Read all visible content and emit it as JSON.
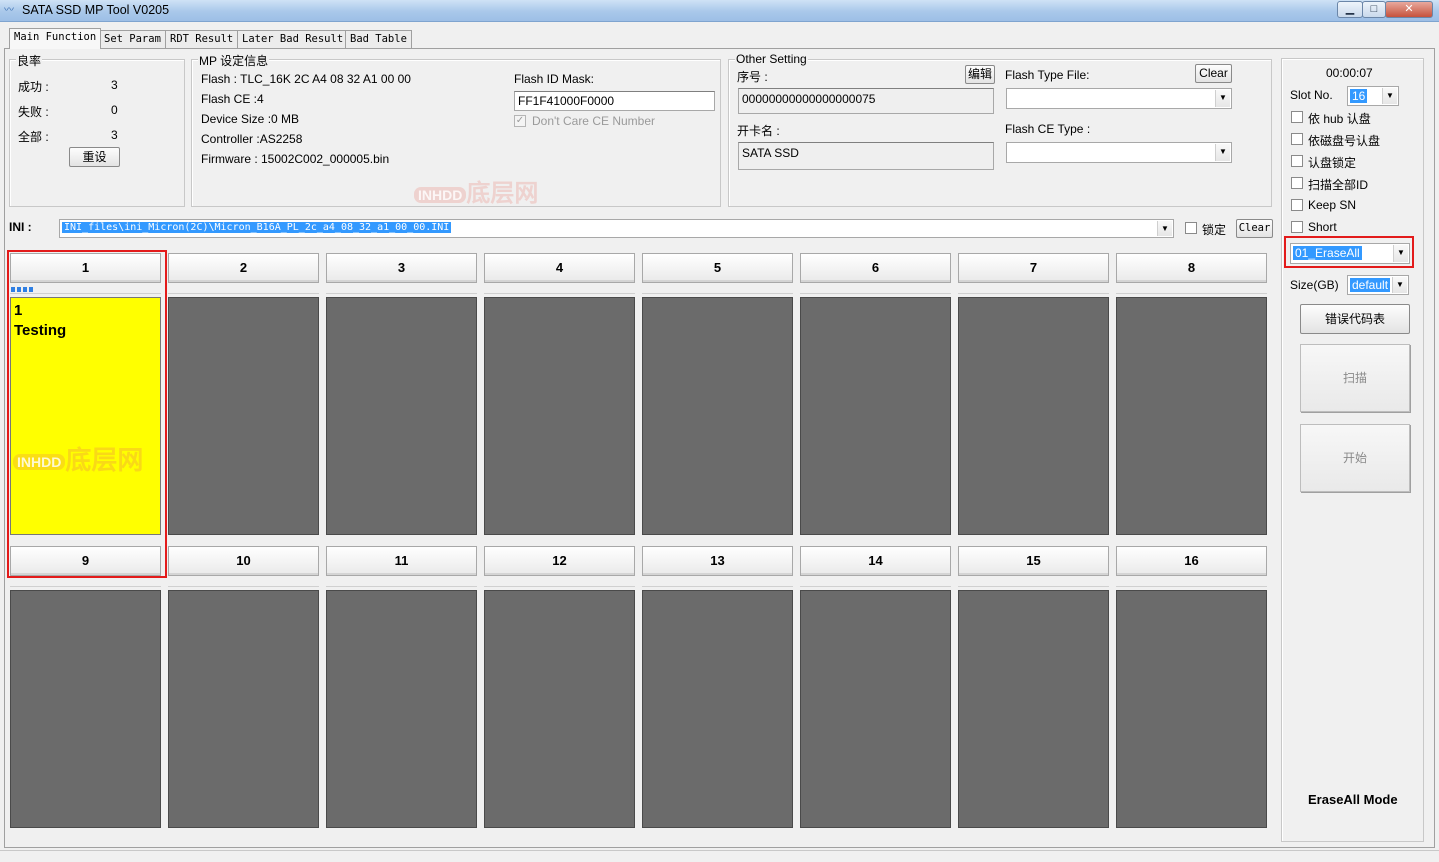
{
  "window": {
    "title": "SATA SSD MP Tool V0205",
    "buttons": {
      "minimize": "▁",
      "maximize": "□",
      "close": "✕"
    }
  },
  "tabs": [
    {
      "label": "Main Function",
      "active": true
    },
    {
      "label": "Set Param",
      "active": false
    },
    {
      "label": "RDT Result",
      "active": false
    },
    {
      "label": "Later Bad Result",
      "active": false
    },
    {
      "label": "Bad Table",
      "active": false
    }
  ],
  "yield_box": {
    "title": "良率",
    "success_label": "成功 :",
    "success_value": "3",
    "fail_label": "失败 :",
    "fail_value": "0",
    "total_label": "全部 :",
    "total_value": "3",
    "reset_label": "重设"
  },
  "mp_info": {
    "title": "MP 设定信息",
    "flash": "Flash : TLC_16K 2C A4 08 32 A1 00 00",
    "flash_ce": "Flash CE :4",
    "device_size": "Device Size :0 MB",
    "controller": "Controller :AS2258",
    "firmware": "Firmware : 15002C002_000005.bin",
    "flash_id_mask_label": "Flash ID Mask:",
    "flash_id_mask_value": "FF1F41000F0000",
    "dont_care_ce_label": "Don't Care CE Number",
    "dont_care_ce_checked": true
  },
  "other_setting": {
    "title": "Other Setting",
    "serial_label": "序号 :",
    "edit_label": "编辑",
    "serial_value": "00000000000000000075",
    "card_name_label": "开卡名 :",
    "card_name_value": "SATA SSD",
    "flash_type_file_label": "Flash Type File:",
    "clear_label": "Clear",
    "flash_type_file_value": "",
    "flash_ce_type_label": "Flash CE Type :",
    "flash_ce_type_value": ""
  },
  "ini": {
    "label": "INI :",
    "value": "INI_files\\ini_Micron(2C)\\Micron_B16A_PL_2c_a4_08_32_a1_00_00.INI",
    "lock_label": "锁定",
    "lock_checked": false,
    "clear_label": "Clear"
  },
  "slots": [
    {
      "number": "1",
      "line1": "1",
      "line2": "Testing",
      "state": "testing",
      "progress_segments": 4
    },
    {
      "number": "2",
      "line1": "",
      "line2": "",
      "state": "idle",
      "progress_segments": 0
    },
    {
      "number": "3",
      "line1": "",
      "line2": "",
      "state": "idle",
      "progress_segments": 0
    },
    {
      "number": "4",
      "line1": "",
      "line2": "",
      "state": "idle",
      "progress_segments": 0
    },
    {
      "number": "5",
      "line1": "",
      "line2": "",
      "state": "idle",
      "progress_segments": 0
    },
    {
      "number": "6",
      "line1": "",
      "line2": "",
      "state": "idle",
      "progress_segments": 0
    },
    {
      "number": "7",
      "line1": "",
      "line2": "",
      "state": "idle",
      "progress_segments": 0
    },
    {
      "number": "8",
      "line1": "",
      "line2": "",
      "state": "idle",
      "progress_segments": 0
    },
    {
      "number": "9",
      "line1": "",
      "line2": "",
      "state": "idle",
      "progress_segments": 0
    },
    {
      "number": "10",
      "line1": "",
      "line2": "",
      "state": "idle",
      "progress_segments": 0
    },
    {
      "number": "11",
      "line1": "",
      "line2": "",
      "state": "idle",
      "progress_segments": 0
    },
    {
      "number": "12",
      "line1": "",
      "line2": "",
      "state": "idle",
      "progress_segments": 0
    },
    {
      "number": "13",
      "line1": "",
      "line2": "",
      "state": "idle",
      "progress_segments": 0
    },
    {
      "number": "14",
      "line1": "",
      "line2": "",
      "state": "idle",
      "progress_segments": 0
    },
    {
      "number": "15",
      "line1": "",
      "line2": "",
      "state": "idle",
      "progress_segments": 0
    },
    {
      "number": "16",
      "line1": "",
      "line2": "",
      "state": "idle",
      "progress_segments": 0
    }
  ],
  "right_panel": {
    "timer": "00:00:07",
    "slot_no_label": "Slot No.",
    "slot_no_value": "16",
    "options": [
      {
        "label": "依 hub 认盘",
        "checked": false
      },
      {
        "label": "依磁盘号认盘",
        "checked": false
      },
      {
        "label": "认盘锁定",
        "checked": false
      },
      {
        "label": "扫描全部ID",
        "checked": false
      },
      {
        "label": "Keep SN",
        "checked": false
      },
      {
        "label": "Short",
        "checked": false
      }
    ],
    "mode_select_value": "01_EraseAll",
    "size_label": "Size(GB)",
    "size_value": "default",
    "error_code_label": "错误代码表",
    "scan_label": "扫描",
    "start_label": "开始",
    "mode_text": "EraseAll Mode"
  },
  "watermark": {
    "badge": "INHDD",
    "text": "底层网"
  },
  "colors": {
    "slot_idle": "#6b6b6b",
    "slot_testing": "#ffff00",
    "highlight": "#e31b1b",
    "progress": "#2f7fe3",
    "selection": "#3399ff"
  }
}
